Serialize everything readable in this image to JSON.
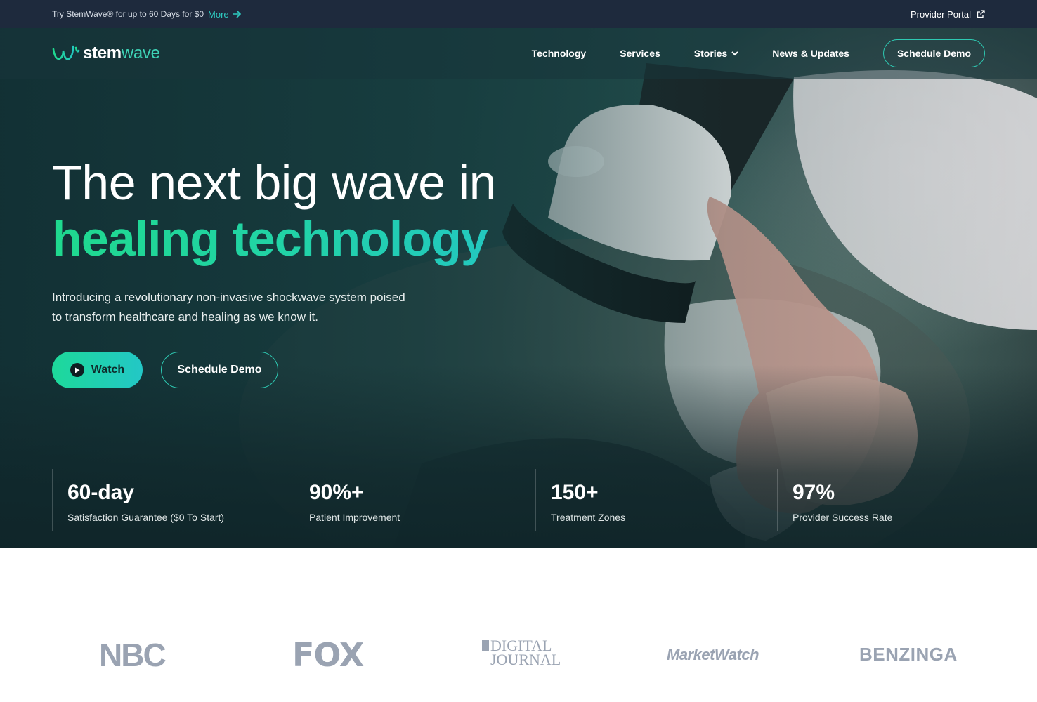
{
  "topbar": {
    "promo_text": "Try StemWave® for up to 60 Days for $0",
    "more_label": "More",
    "portal_label": "Provider Portal"
  },
  "nav": {
    "logo_text_bold": "stem",
    "logo_text_light": "wave",
    "links": [
      {
        "label": "Technology"
      },
      {
        "label": "Services"
      },
      {
        "label": "Stories"
      },
      {
        "label": "News & Updates"
      }
    ],
    "cta_label": "Schedule Demo"
  },
  "hero": {
    "headline_line1": "The next big wave in",
    "headline_line2": "healing technology",
    "subtext": "Introducing a revolutionary non-invasive shockwave system poised to transform healthcare and healing as we know it.",
    "watch_label": "Watch",
    "demo_label": "Schedule Demo"
  },
  "stats": [
    {
      "value": "60-day",
      "label": "Satisfaction Guarantee ($0 To Start)"
    },
    {
      "value": "90%+",
      "label": "Patient Improvement"
    },
    {
      "value": "150+",
      "label": "Treatment Zones"
    },
    {
      "value": "97%",
      "label": "Provider Success Rate"
    }
  ],
  "press": {
    "nbc": "NBC",
    "fox": "FOX",
    "digital_journal_1": "DIGITAL",
    "digital_journal_2": "JOURNAL",
    "marketwatch": "MarketWatch",
    "benzinga": "BENZINGA"
  },
  "colors": {
    "accent_teal": "#2ec9b2",
    "accent_green": "#1fd98e",
    "topbar_bg": "#1e2a3d",
    "logo_gray": "#9aa3b2"
  }
}
